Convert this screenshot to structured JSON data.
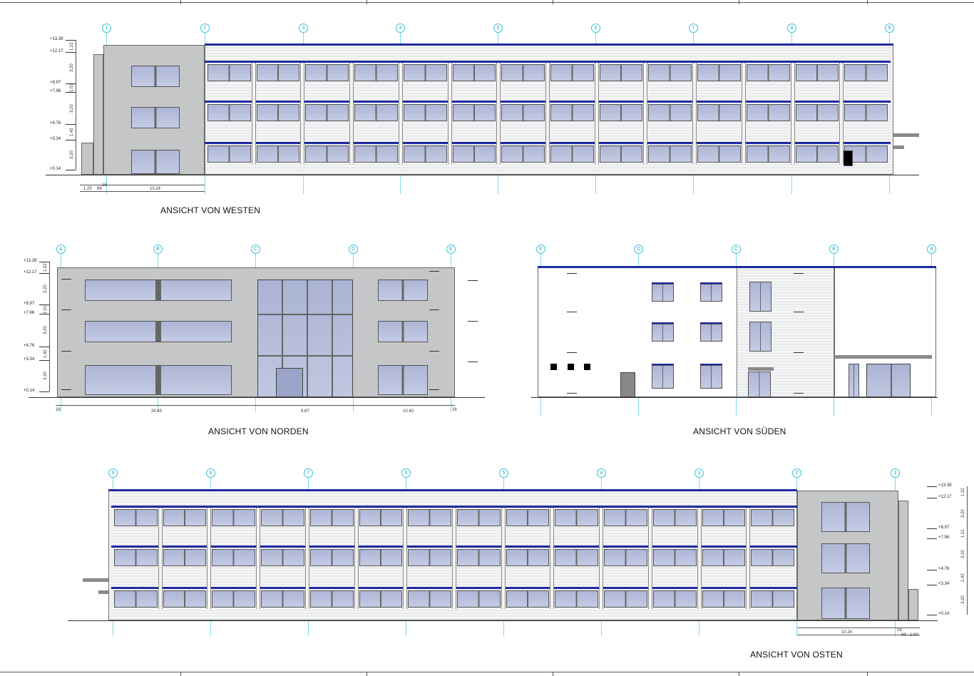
{
  "views": [
    {
      "id": "west",
      "title": "ANSICHT VON WESTEN",
      "axes": [
        "1",
        "2",
        "3",
        "4",
        "5",
        "6",
        "7",
        "8",
        "9"
      ],
      "levels": [
        "+13.39",
        "+12.17",
        "+8.97",
        "+7.96",
        "+4.76",
        "+3.34",
        "+0.14"
      ],
      "heights": [
        "1.22",
        "3.20",
        "1.01",
        "3.20",
        "1.42",
        "3.20"
      ],
      "dims_bottom": [
        "1.25",
        "99",
        "16",
        "10.24"
      ]
    },
    {
      "id": "north",
      "title": "ANSICHT VON NORDEN",
      "axes": [
        "A",
        "B",
        "C",
        "D",
        "E"
      ],
      "levels": [
        "+13.39",
        "+12.17",
        "+8.97",
        "+7.96",
        "+4.76",
        "+3.34",
        "+0.14"
      ],
      "heights": [
        "1.22",
        "3.20",
        "1.01",
        "3.20",
        "1.42",
        "3.20"
      ],
      "dims_bottom": [
        "16",
        "20.43",
        "9.67",
        "10.40",
        "16"
      ]
    },
    {
      "id": "south",
      "title": "ANSICHT VON SÜDEN",
      "axes": [
        "E",
        "D",
        "C",
        "B",
        "A"
      ]
    },
    {
      "id": "east",
      "title": "ANSICHT VON OSTEN",
      "axes": [
        "9",
        "8",
        "7",
        "6",
        "5",
        "4",
        "3",
        "2",
        "1"
      ],
      "levels": [
        "+13.39",
        "+12.17",
        "+8.97",
        "+7.96",
        "+4.76",
        "+3.34",
        "+0.14"
      ],
      "heights": [
        "1.22",
        "3.20",
        "1.01",
        "3.20",
        "1.42",
        "3.20"
      ],
      "dims_bottom": [
        "10.24",
        "16",
        "99",
        "1.00"
      ]
    }
  ],
  "colors": {
    "band": "#1f2aa0",
    "axis": "#33c3d6",
    "glass": "#b4bcdb",
    "panel": "#c5c6c8"
  }
}
